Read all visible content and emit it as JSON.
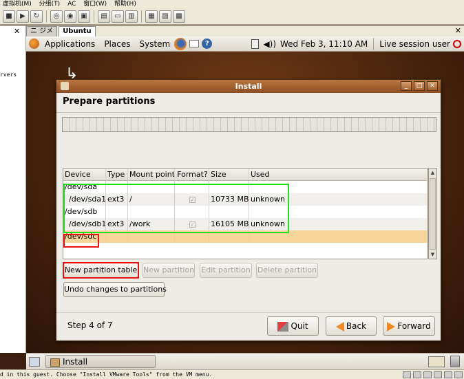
{
  "vmware": {
    "menu": [
      "虚拟机(M)",
      "分组(T)",
      "AC",
      "窗口(W)",
      "帮助(H)"
    ],
    "tabs": [
      "ニ ジメ",
      "Ubuntu"
    ],
    "left_panel_text": "rvers",
    "status_text": "d in this guest. Choose \"Install VMware Tools\" from the VM menu."
  },
  "gnome_panel": {
    "applications": "Applications",
    "places": "Places",
    "system": "System",
    "clock": "Wed Feb  3, 11:10 AM",
    "user": "Live session user"
  },
  "installer": {
    "window_title": "Install",
    "page_title": "Prepare partitions",
    "table": {
      "headers": [
        "Device",
        "Type",
        "Mount point",
        "Format?",
        "Size",
        "Used"
      ],
      "rows": [
        {
          "device": "/dev/sda",
          "type": "",
          "mount": "",
          "format": false,
          "size": "",
          "used": ""
        },
        {
          "device": "  /dev/sda1",
          "type": "ext3",
          "mount": "/",
          "format": true,
          "size": "10733 MB",
          "used": "unknown"
        },
        {
          "device": "/dev/sdb",
          "type": "",
          "mount": "",
          "format": false,
          "size": "",
          "used": ""
        },
        {
          "device": "  /dev/sdb1",
          "type": "ext3",
          "mount": "/work",
          "format": true,
          "size": "16105 MB",
          "used": "unknown"
        },
        {
          "device": "/dev/sdc",
          "type": "",
          "mount": "",
          "format": false,
          "size": "",
          "used": "",
          "selected": true
        }
      ]
    },
    "buttons": {
      "new_table": "New partition table",
      "new_partition": "New partition",
      "edit_partition": "Edit partition",
      "delete_partition": "Delete partition",
      "undo": "Undo changes to partitions",
      "quit": "Quit",
      "back": "Back",
      "forward": "Forward"
    },
    "step": "Step 4 of 7"
  },
  "taskbar": {
    "install": "Install"
  },
  "colors": {
    "highlight_green": "#1ee01e",
    "highlight_red": "#e81414",
    "selected_row": "#f7d59b"
  }
}
